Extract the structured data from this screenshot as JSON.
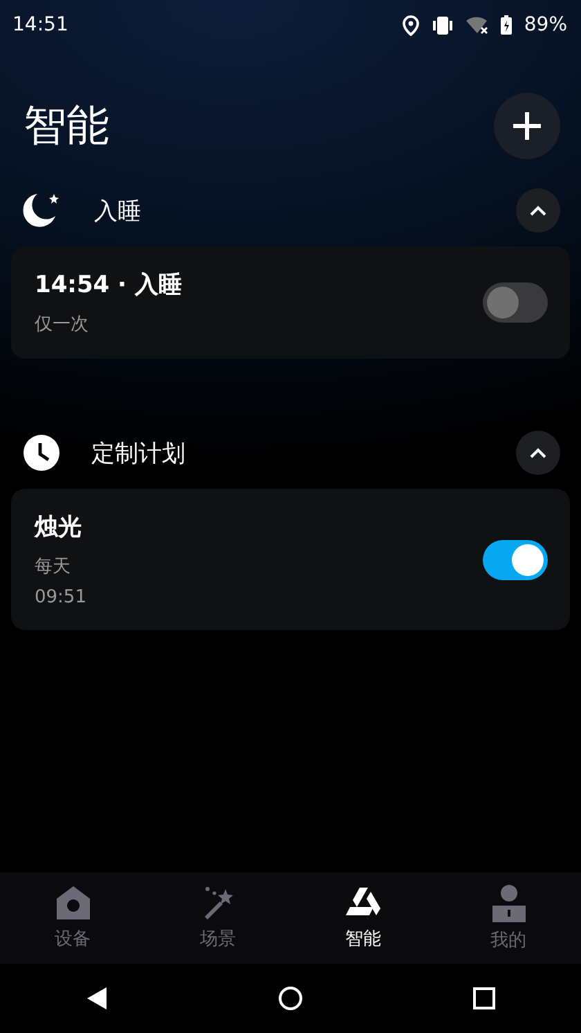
{
  "status_bar": {
    "time": "14:51",
    "battery": "89%"
  },
  "title": "智能",
  "sections": [
    {
      "title": "入睡",
      "expanded": true,
      "items": [
        {
          "title": "14:54 · 入睡",
          "lines": [
            "仅一次"
          ],
          "on": false
        }
      ]
    },
    {
      "title": "定制计划",
      "expanded": true,
      "items": [
        {
          "title": "烛光",
          "lines": [
            "每天",
            "09:51"
          ],
          "on": true
        }
      ]
    }
  ],
  "tabs": [
    {
      "label": "设备",
      "selected": false
    },
    {
      "label": "场景",
      "selected": false
    },
    {
      "label": "智能",
      "selected": true
    },
    {
      "label": "我的",
      "selected": false
    }
  ]
}
